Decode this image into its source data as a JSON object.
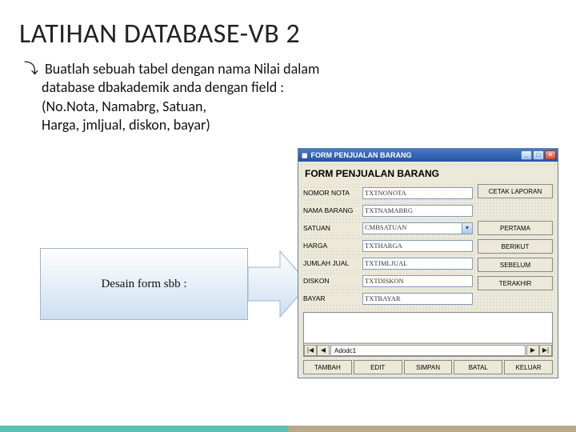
{
  "slide": {
    "title": "LATIHAN DATABASE-VB 2",
    "body_line1": "Buatlah sebuah tabel dengan nama Nilai dalam",
    "body_line2": "database dbakademik anda dengan field :",
    "body_line3": "(No.Nota, Namabrg, Satuan,",
    "body_line4": "Harga, jmljual, diskon, bayar)",
    "desain_label": "Desain form sbb :"
  },
  "window": {
    "title_caption": "FORM PENJUALAN BARANG",
    "form_title": "FORM PENJUALAN BARANG",
    "fields": [
      {
        "label": "NOMOR NOTA",
        "value": "TXTNONOTA",
        "type": "text"
      },
      {
        "label": "NAMA BARANG",
        "value": "TXTNAMABRG",
        "type": "text"
      },
      {
        "label": "SATUAN",
        "value": "CMBSATUAN",
        "type": "combo"
      },
      {
        "label": "HARGA",
        "value": "TXTHARGA",
        "type": "text"
      },
      {
        "label": "JUMLAH JUAL",
        "value": "TXTJMLJUAL",
        "type": "text"
      },
      {
        "label": "DISKON",
        "value": "TXTDISKON",
        "type": "text"
      },
      {
        "label": "BAYAR",
        "value": "TXTBAYAR",
        "type": "text"
      }
    ],
    "side_buttons": [
      "CETAK LAPORAN",
      "PERTAMA",
      "BERIKUT",
      "SEBELUM",
      "TERAKHIR"
    ],
    "footer_buttons": [
      "TAMBAH",
      "EDIT",
      "SIMPAN",
      "BATAL",
      "KELUAR"
    ],
    "nav_text": "Adodc1"
  }
}
